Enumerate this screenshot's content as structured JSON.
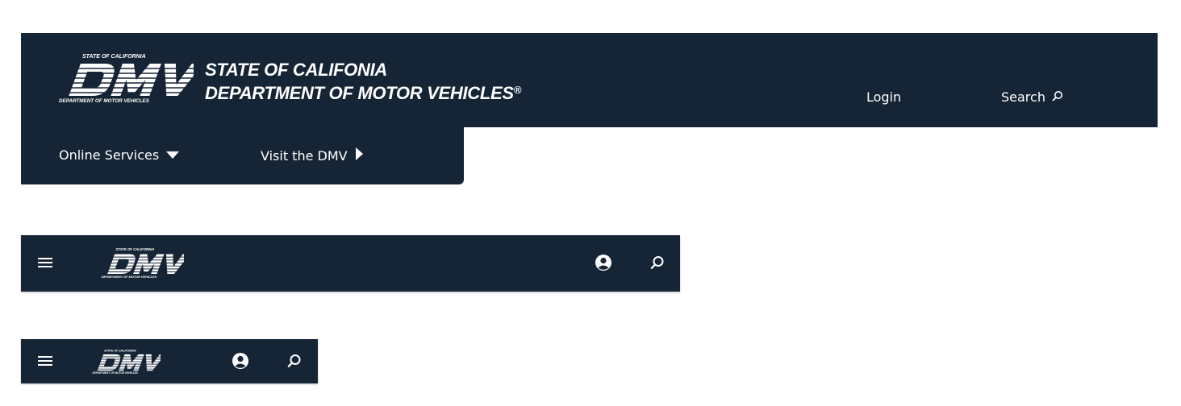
{
  "logo": {
    "top_text": "STATE OF CALIFORNIA",
    "mark": "DMV",
    "bottom_text": "DEPARTMENT OF MOTOR VEHICLES"
  },
  "header": {
    "agency_line1": "STATE OF CALIFONIA",
    "agency_line2": "DEPARTMENT OF MOTOR VEHICLES",
    "agency_mark": "®",
    "login_label": "Login",
    "search_label": "Search"
  },
  "subnav": {
    "online_services_label": "Online Services",
    "visit_dmv_label": "Visit the DMV"
  },
  "icons": {
    "menu": "hamburger-menu-icon",
    "user": "user-account-icon",
    "search": "magnifier-search-icon",
    "dropdown": "caret-down-icon",
    "arrow": "caret-right-icon"
  },
  "colors": {
    "header_background": "#152536",
    "text": "#ffffff"
  }
}
